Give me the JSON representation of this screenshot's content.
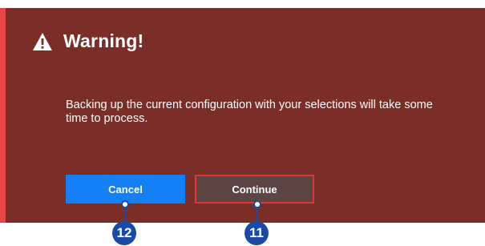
{
  "dialog": {
    "icon": "warning-triangle-icon",
    "title": "Warning!",
    "message": "Backing up the current configuration with your selections will take some time to process.",
    "background_color": "#7a2e27",
    "accent_color": "#e84545"
  },
  "buttons": {
    "cancel_label": "Cancel",
    "continue_label": "Continue",
    "cancel_color": "#1580f5",
    "continue_color": "#5c4543",
    "continue_border_color": "#e0353b"
  },
  "callouts": {
    "cancel_number": "12",
    "continue_number": "11",
    "color": "#1a4aa6"
  }
}
